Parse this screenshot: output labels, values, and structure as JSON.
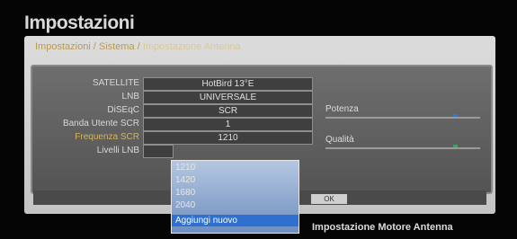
{
  "page": {
    "title": "Impostazioni"
  },
  "breadcrumb": {
    "parent": "Impostazioni / Sistema",
    "separator": " / ",
    "current": "Impostazione Antenna"
  },
  "settings": {
    "satellite": {
      "label": "SATELLITE",
      "value": "HotBird 13°E"
    },
    "lnb": {
      "label": "LNB",
      "value": "UNIVERSALE"
    },
    "diseqc": {
      "label": "DiSEqC",
      "value": "SCR"
    },
    "user_band": {
      "label": "Banda Utente SCR",
      "value": "1"
    },
    "scr_frequency": {
      "label": "Frequenza SCR",
      "value": "1210"
    },
    "lnb_level": {
      "label": "Livelli LNB",
      "value": ""
    }
  },
  "meters": {
    "power": {
      "label": "Potenza",
      "color": "#2f79d6"
    },
    "quality": {
      "label": "Qualità",
      "color": "#2fae5a"
    }
  },
  "frequency_dropdown": {
    "options": [
      "1210",
      "1420",
      "1680",
      "2040",
      "Aggiungi nuovo"
    ],
    "selected_index": 4
  },
  "footer": {
    "confirm_chip": "OK",
    "motor_hint": "Impostazione Motore Antenna"
  }
}
